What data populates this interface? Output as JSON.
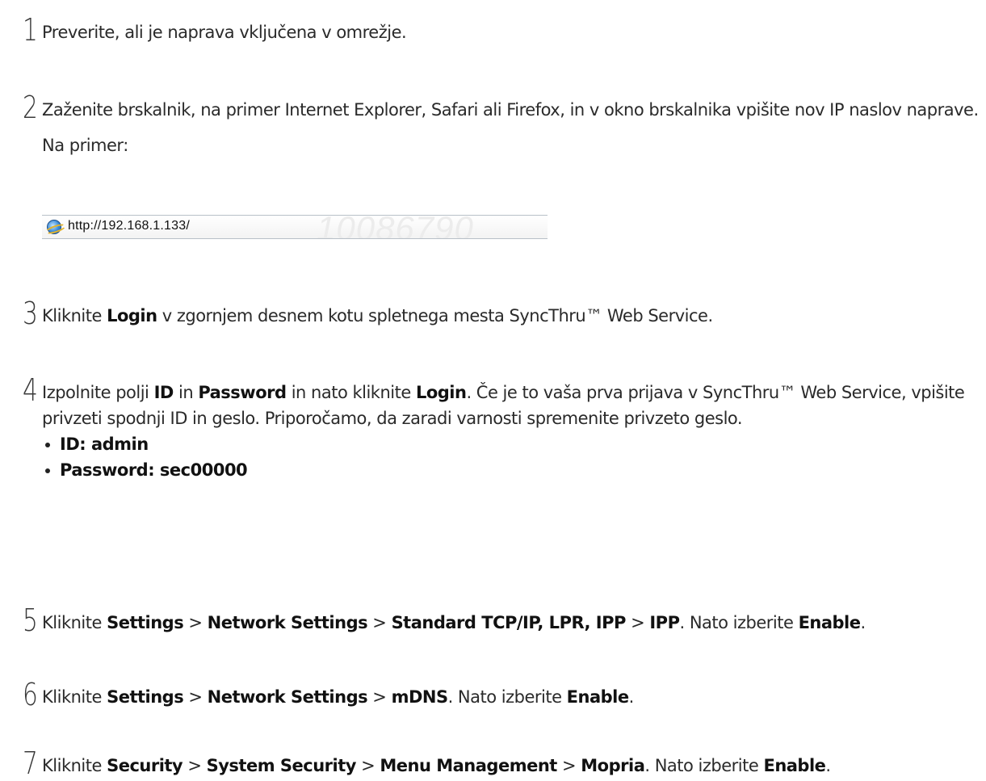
{
  "steps": [
    {
      "num": "1",
      "text": "Preverite, ali je naprava vključena v omrežje."
    },
    {
      "num": "2",
      "text": "Zaženite brskalnik, na primer Internet Explorer, Safari ali Firefox, in v okno brskalnika vpišite nov IP naslov naprave.",
      "example_label": "Na primer:",
      "address_bar": {
        "url": "http://192.168.1.133/",
        "watermark": "10086790",
        "icon": "internet-explorer-icon"
      }
    },
    {
      "num": "3",
      "pre": "Kliknite ",
      "b1": "Login",
      "post": " v zgornjem desnem kotu spletnega mesta SyncThru™ Web Service."
    },
    {
      "num": "4",
      "pre": "Izpolnite polji ",
      "b1": "ID",
      "mid1": " in ",
      "b2": "Password",
      "mid2": " in nato kliknite ",
      "b3": "Login",
      "post": ". Če je to vaša prva prijava v SyncThru™ Web Service, vpišite privzeti spodnji ID in geslo. Priporočamo, da zaradi varnosti spremenite privzeto geslo.",
      "bullets": [
        "ID: admin",
        "Password: sec00000"
      ]
    },
    {
      "num": "5",
      "pre": "Kliknite ",
      "b1": "Settings",
      "s1": " > ",
      "b2": "Network Settings",
      "s2": " > ",
      "b3": "Standard TCP/IP, LPR, IPP",
      "s3": " > ",
      "b4": "IPP",
      "post": ". Nato izberite ",
      "b5": "Enable",
      "end": "."
    },
    {
      "num": "6",
      "pre": "Kliknite ",
      "b1": "Settings",
      "s1": " > ",
      "b2": "Network Settings",
      "s2": " > ",
      "b3": "mDNS",
      "post": ". Nato izberite ",
      "b4": "Enable",
      "end": "."
    },
    {
      "num": "7",
      "pre": "Kliknite ",
      "b1": "Security",
      "s1": " > ",
      "b2": "System Security",
      "s2": " > ",
      "b3": "Menu Management",
      "s3": " > ",
      "b4": "Mopria",
      "post": ". Nato izberite ",
      "b5": "Enable",
      "end": "."
    }
  ]
}
